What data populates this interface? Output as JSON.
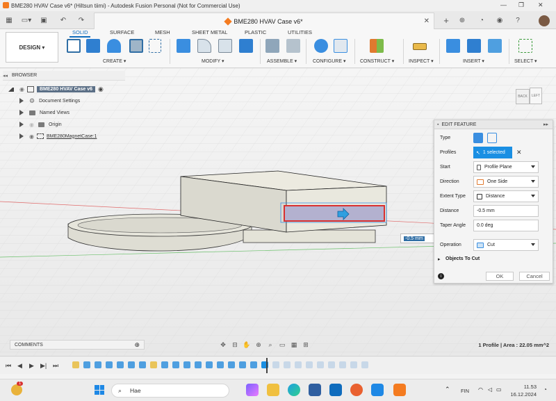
{
  "window": {
    "title": "BME280 HVAV Case v6* (Hiltsun tiimi) - Autodesk Fusion Personal (Not for Commercial Use)",
    "min_glyph": "—",
    "max_glyph": "❐",
    "close_glyph": "✕"
  },
  "tabbar": {
    "doc_tab": "BME280 HVAV Case v6*",
    "close_glyph": "✕",
    "plus_glyph": "+"
  },
  "ribbon": {
    "design_label": "DESIGN ▾",
    "tabs": [
      "SOLID",
      "SURFACE",
      "MESH",
      "SHEET METAL",
      "PLASTIC",
      "UTILITIES"
    ],
    "groups": [
      "CREATE ▾",
      "MODIFY ▾",
      "ASSEMBLE ▾",
      "CONFIGURE ▾",
      "CONSTRUCT ▾",
      "INSPECT ▾",
      "INSERT ▾",
      "SELECT ▾"
    ]
  },
  "browser": {
    "header": "BROWSER",
    "root": "BME280 HVAV Case v6",
    "items": [
      "Document Settings",
      "Named Views",
      "Origin",
      "BME280MagnetCase:1"
    ]
  },
  "viewcube": {
    "left_label": "LEFT",
    "back_label": "BACK"
  },
  "edit_feature": {
    "title": "EDIT FEATURE",
    "rows": {
      "type_label": "Type",
      "profiles_label": "Profiles",
      "profiles_value": "1 selected",
      "start_label": "Start",
      "start_value": "Profile Plane",
      "direction_label": "Direction",
      "direction_value": "One Side",
      "extent_label": "Extent Type",
      "extent_value": "Distance",
      "distance_label": "Distance",
      "distance_value": "-0.5 mm",
      "taper_label": "Taper Angle",
      "taper_value": "0.0 deg",
      "operation_label": "Operation",
      "operation_value": "Cut",
      "objects_label": "Objects To Cut"
    },
    "ok": "OK",
    "cancel": "Cancel"
  },
  "viewport": {
    "distance_tag": "-0.5 mm"
  },
  "comments": {
    "label": "COMMENTS"
  },
  "status": {
    "text": "1 Profile | Area : 22.05 mm^2"
  },
  "taskbar": {
    "search_placeholder": "Hae",
    "notification_count": "1",
    "lang": "FIN",
    "time": "11.53",
    "date": "16.12.2024"
  },
  "colors": {
    "accent": "#0f6cbd",
    "brand": "#f47b20",
    "cut_profile": "#d83030"
  }
}
